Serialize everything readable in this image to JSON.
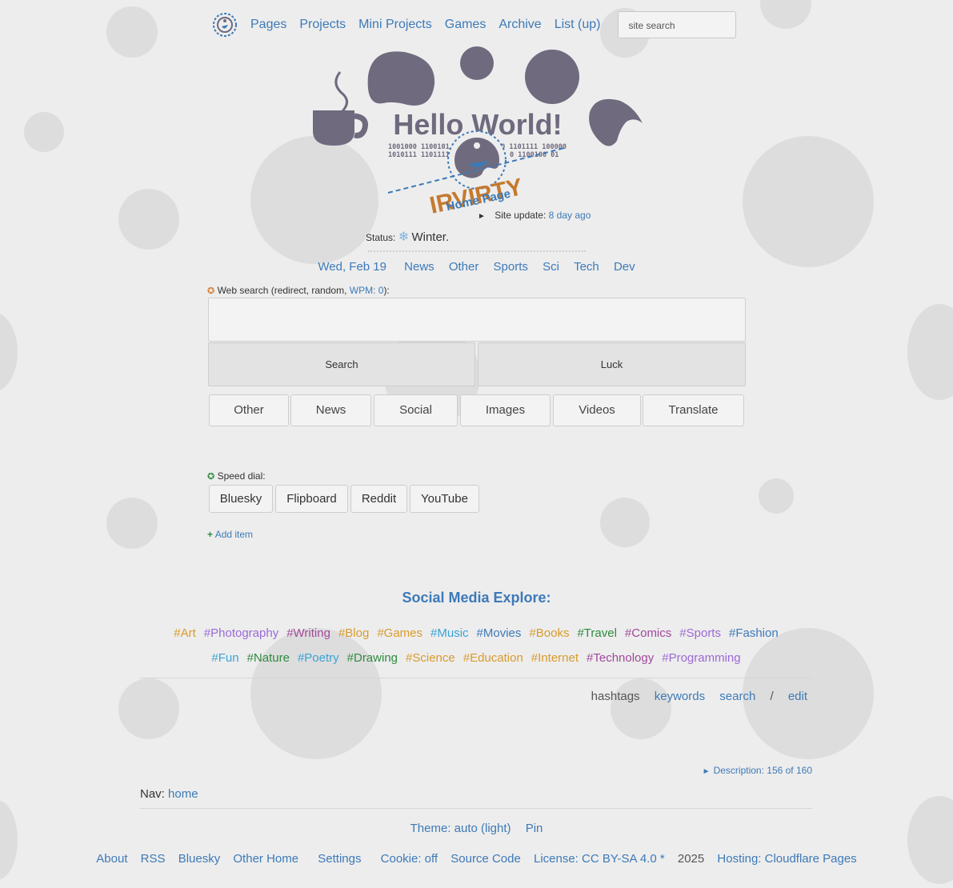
{
  "topnav": {
    "items": [
      "Pages",
      "Projects",
      "Mini Projects",
      "Games",
      "Archive",
      "List (up)"
    ],
    "search_placeholder": "site search"
  },
  "hero": {
    "title": "Hello World!",
    "binary_left_1": "1001000 1100101",
    "binary_left_2": "1010111 1101111",
    "binary_right_1": "00 1101111 100000",
    "binary_right_2": "0 1100100 01",
    "brand": "IRVIRTY",
    "subtitle": "Home Page"
  },
  "site_update": {
    "label": "Site update:",
    "value": "8 day ago"
  },
  "status": {
    "label": "Status:",
    "value": "Winter."
  },
  "topics": [
    "Wed, Feb 19",
    "News",
    "Other",
    "Sports",
    "Sci",
    "Tech",
    "Dev"
  ],
  "web_search": {
    "label_prefix": "Web search (redirect, random, ",
    "wpm_label": "WPM: ",
    "wpm_value": "0",
    "label_suffix": "):",
    "search_button": "Search",
    "luck_button": "Luck",
    "categories": [
      "Other",
      "News",
      "Social",
      "Images",
      "Videos",
      "Translate"
    ]
  },
  "speed_dial": {
    "label": "Speed dial:",
    "items": [
      "Bluesky",
      "Flipboard",
      "Reddit",
      "YouTube"
    ],
    "add_item": "Add item"
  },
  "social_explore": {
    "title": "Social Media Explore:",
    "row1": [
      {
        "text": "#Art",
        "color": "#d99b2b"
      },
      {
        "text": "#Photography",
        "color": "#9b6ad6"
      },
      {
        "text": "#Writing",
        "color": "#a04a9c"
      },
      {
        "text": "#Blog",
        "color": "#d99b2b"
      },
      {
        "text": "#Games",
        "color": "#d99b2b"
      },
      {
        "text": "#Music",
        "color": "#3aa3d6"
      },
      {
        "text": "#Movies",
        "color": "#3d7ab8"
      },
      {
        "text": "#Books",
        "color": "#d99b2b"
      },
      {
        "text": "#Travel",
        "color": "#2e8b3e"
      },
      {
        "text": "#Comics",
        "color": "#a04a9c"
      },
      {
        "text": "#Sports",
        "color": "#9b6ad6"
      },
      {
        "text": "#Fashion",
        "color": "#3d7ab8"
      }
    ],
    "row2": [
      {
        "text": "#Fun",
        "color": "#3aa3d6"
      },
      {
        "text": "#Nature",
        "color": "#2e8b3e"
      },
      {
        "text": "#Poetry",
        "color": "#3aa3d6"
      },
      {
        "text": "#Drawing",
        "color": "#2e8b3e"
      },
      {
        "text": "#Science",
        "color": "#d99b2b"
      },
      {
        "text": "#Education",
        "color": "#d99b2b"
      },
      {
        "text": "#Internet",
        "color": "#d99b2b"
      },
      {
        "text": "#Technology",
        "color": "#a04a9c"
      },
      {
        "text": "#Programming",
        "color": "#9b6ad6"
      }
    ],
    "hashtags_label": "hashtags",
    "keywords_label": "keywords",
    "search_label": "search",
    "separator": "/",
    "edit_label": "edit"
  },
  "description": {
    "label": "Description: 156 of 160"
  },
  "nav": {
    "label": "Nav:",
    "home": "home"
  },
  "theme_row": {
    "theme": "Theme: auto (light)",
    "pin": "Pin"
  },
  "footer": {
    "about": "About",
    "rss": "RSS",
    "bluesky": "Bluesky",
    "other_home": "Other Home",
    "settings": "Settings",
    "cookie": "Cookie: off",
    "source_code": "Source Code",
    "license": "License: CC BY-SA 4.0 *",
    "year": "2025",
    "hosting": "Hosting: Cloudflare Pages"
  },
  "colors": {
    "link": "#3d7ab8",
    "background": "#ededed",
    "hero_shape": "#6f6a7e",
    "accent_orange": "#c57a2e",
    "add_green": "#2e8b3e"
  }
}
